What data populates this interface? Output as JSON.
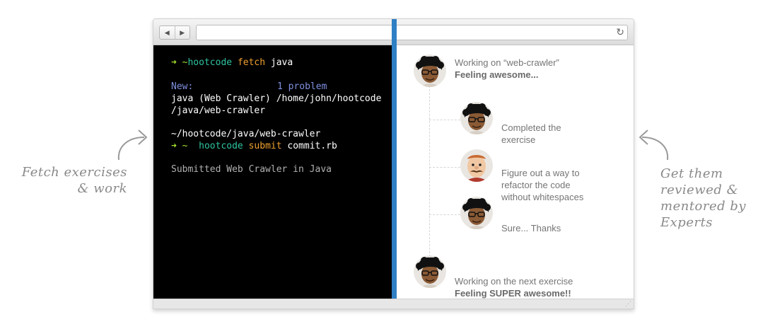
{
  "captions": {
    "left": [
      "Fetch exercises",
      "& work"
    ],
    "right": [
      "Get them",
      "reviewed &",
      "mentored by",
      "Experts"
    ]
  },
  "browser": {
    "back_icon": "◀",
    "forward_icon": "▶",
    "reload_icon": "↻",
    "address": ""
  },
  "terminal": {
    "prompt_arrow": "➜",
    "prompt_dir": "~",
    "lines": {
      "cmd1": {
        "program": "hootcode",
        "subcommand": "fetch",
        "arg": "java"
      },
      "new_label": "New:",
      "new_value": "1 problem",
      "fetched_line1": "java (Web Crawler) /home/john/hootcode",
      "fetched_line2": "/java/web-crawler",
      "cwd": "~/hootcode/java/web-crawler",
      "cmd2": {
        "program": "hootcode",
        "subcommand": "submit",
        "arg": "commit.rb"
      },
      "result": "Submitted Web Crawler in Java"
    }
  },
  "chat": {
    "messages": [
      {
        "line1": "Working on “web-crawler”",
        "line2": "Feeling awesome..."
      },
      {
        "line1": "Completed the",
        "line2": "exercise"
      },
      {
        "line1": "Figure out a way to",
        "line2": "refactor the code",
        "line3": "without whitespaces"
      },
      {
        "line1": "Sure... Thanks"
      },
      {
        "line1": "Working on the next exercise",
        "line2": "Feeling SUPER awesome!!"
      }
    ]
  },
  "colors": {
    "divider": "#2e7fc3",
    "terminal_bg": "#000000",
    "prompt_arrow": "#a6e22e",
    "program": "#2ec4a0",
    "subcommand": "#f0a030",
    "label": "#7f8fe0"
  },
  "icons": [
    "back-arrow-icon",
    "forward-arrow-icon",
    "reload-icon",
    "curved-arrow-icon",
    "student-avatar",
    "mentor-avatar",
    "resize-grip-icon"
  ]
}
